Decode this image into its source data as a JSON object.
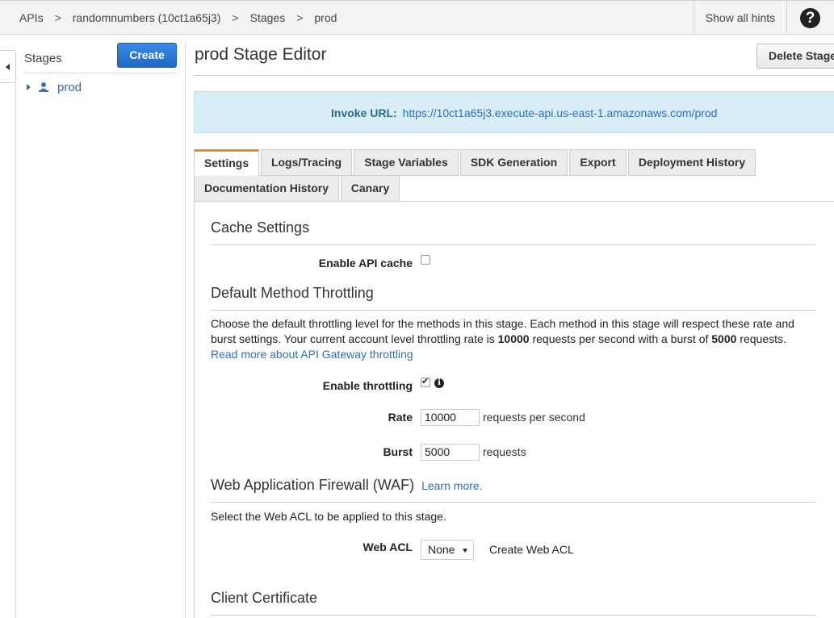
{
  "breadcrumb": {
    "items": [
      "APIs",
      "randomnumbers (10ct1a65j3)",
      "Stages",
      "prod"
    ],
    "separator": ">"
  },
  "topbar": {
    "hints_label": "Show all hints",
    "help_glyph": "?"
  },
  "sidebar": {
    "title": "Stages",
    "create_label": "Create",
    "stages": [
      {
        "label": "prod",
        "icon": "stage-icon"
      }
    ]
  },
  "header": {
    "title": "prod Stage Editor",
    "delete_label": "Delete Stage"
  },
  "invoke": {
    "label": "Invoke URL:",
    "url": "https://10ct1a65j3.execute-api.us-east-1.amazonaws.com/prod"
  },
  "tabs": [
    {
      "label": "Settings",
      "active": true
    },
    {
      "label": "Logs/Tracing",
      "active": false
    },
    {
      "label": "Stage Variables",
      "active": false
    },
    {
      "label": "SDK Generation",
      "active": false
    },
    {
      "label": "Export",
      "active": false
    },
    {
      "label": "Deployment History",
      "active": false
    },
    {
      "label": "Documentation History",
      "active": false
    },
    {
      "label": "Canary",
      "active": false
    }
  ],
  "cache": {
    "heading": "Cache Settings",
    "enable_label": "Enable API cache",
    "enabled": false
  },
  "throttling": {
    "heading": "Default Method Throttling",
    "desc_part1": "Choose the default throttling level for the methods in this stage. Each method in this stage will respect these rate and burst settings. Your current account level throttling rate is ",
    "account_rate": "10000",
    "desc_part2": " requests per second with a burst of ",
    "account_burst": "5000",
    "desc_part3": " requests.",
    "read_more": "Read more about API Gateway throttling",
    "enable_label": "Enable throttling",
    "enabled": true,
    "rate_label": "Rate",
    "rate_value": "10000",
    "rate_unit": "requests per second",
    "burst_label": "Burst",
    "burst_value": "5000",
    "burst_unit": "requests"
  },
  "waf": {
    "heading": "Web Application Firewall (WAF)",
    "learn_more": "Learn more.",
    "desc": "Select the Web ACL to be applied to this stage.",
    "acl_label": "Web ACL",
    "acl_value": "None",
    "create_link": "Create Web ACL"
  },
  "client_cert": {
    "heading": "Client Certificate"
  },
  "colors": {
    "primary_button": "#2f7bd8",
    "link": "#2c6fb8",
    "active_tab_accent": "#e38c23",
    "invoke_bg": "#d8edf5"
  }
}
